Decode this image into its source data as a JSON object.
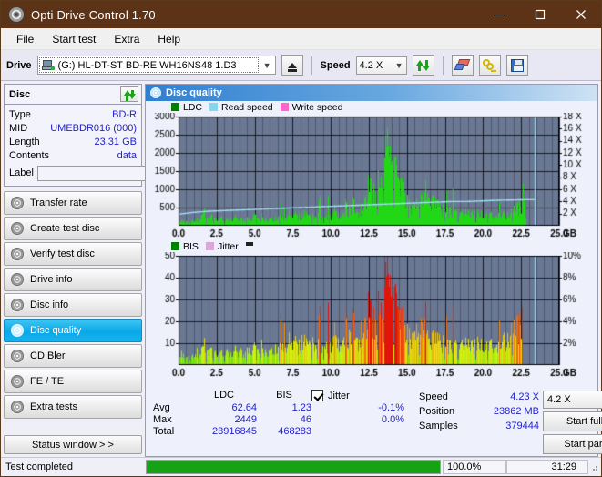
{
  "window": {
    "title": "Opti Drive Control 1.70",
    "minimize": "–",
    "maximize": "□",
    "close": "✕"
  },
  "menu": {
    "items": [
      "File",
      "Start test",
      "Extra",
      "Help"
    ]
  },
  "toolbar": {
    "drive_label": "Drive",
    "drive_value": "(G:)  HL-DT-ST BD-RE  WH16NS48 1.D3",
    "eject_title": "Eject",
    "speed_label": "Speed",
    "speed_value": "4.2 X",
    "refresh_title": "Refresh",
    "erase_title": "Erase",
    "key_title": "Tools",
    "save_title": "Save"
  },
  "disc_panel": {
    "title": "Disc",
    "refresh_title": "Refresh disc",
    "rows": [
      {
        "key": "Type",
        "value": "BD-R"
      },
      {
        "key": "MID",
        "value": "UMEBDR016 (000)"
      },
      {
        "key": "Length",
        "value": "23.31 GB"
      },
      {
        "key": "Contents",
        "value": "data"
      }
    ],
    "label_key": "Label",
    "label_value": ""
  },
  "nav": {
    "items": [
      {
        "label": "Transfer rate",
        "selected": false
      },
      {
        "label": "Create test disc",
        "selected": false
      },
      {
        "label": "Verify test disc",
        "selected": false
      },
      {
        "label": "Drive info",
        "selected": false
      },
      {
        "label": "Disc info",
        "selected": false
      },
      {
        "label": "Disc quality",
        "selected": true
      },
      {
        "label": "CD Bler",
        "selected": false
      },
      {
        "label": "FE / TE",
        "selected": false
      },
      {
        "label": "Extra tests",
        "selected": false
      }
    ],
    "status_window": "Status window > >"
  },
  "main": {
    "header": "Disc quality"
  },
  "stats": {
    "col_headers": [
      "LDC",
      "BIS"
    ],
    "jitter_label": "Jitter",
    "jitter_checked": true,
    "rows": [
      {
        "label": "Avg",
        "ldc": "62.64",
        "bis": "1.23",
        "jitter": "-0.1%"
      },
      {
        "label": "Max",
        "ldc": "2449",
        "bis": "46",
        "jitter": "0.0%"
      },
      {
        "label": "Total",
        "ldc": "23916845",
        "bis": "468283",
        "jitter": ""
      }
    ],
    "speed_key": "Speed",
    "speed_value": "4.23 X",
    "position_key": "Position",
    "position_value": "23862 MB",
    "samples_key": "Samples",
    "samples_value": "379444",
    "speed_select": "4.2 X",
    "start_full": "Start full",
    "start_part": "Start part"
  },
  "statusbar": {
    "message": "Test completed",
    "progress_percent": "100.0%",
    "progress_value": 100,
    "elapsed": "31:29"
  },
  "chart_data": [
    {
      "type": "area",
      "name": "ldc-chart",
      "title": "",
      "xlabel": "GB",
      "ylabel": "LDC",
      "xlim": [
        0,
        25
      ],
      "ylim": [
        0,
        3000
      ],
      "xticks": [
        "0.0",
        "2.5",
        "5.0",
        "7.5",
        "10.0",
        "12.5",
        "15.0",
        "17.5",
        "20.0",
        "22.5",
        "25.0"
      ],
      "yticks": [
        500,
        1000,
        1500,
        2000,
        2500,
        3000
      ],
      "y2lim": [
        0,
        18
      ],
      "y2ticks": [
        "2 X",
        "4 X",
        "6 X",
        "8 X",
        "10 X",
        "12 X",
        "14 X",
        "16 X",
        "18 X"
      ],
      "y2label": "X",
      "grid": true,
      "legend_position": "top-left",
      "legend": [
        {
          "name": "LDC",
          "color": "#008000"
        },
        {
          "name": "Read speed",
          "color": "#87d6f0"
        },
        {
          "name": "Write speed",
          "color": "#ff66cc"
        }
      ],
      "plot_bg": "#6b7894",
      "data_end_gb": 23.4,
      "cursor_color": "#7fe0f5",
      "series": [
        {
          "name": "LDC",
          "color": "#22d816",
          "kind": "bars",
          "x": [
            0.0,
            0.2,
            0.4,
            0.6,
            0.8,
            1.0,
            1.2,
            1.4,
            1.6,
            1.8,
            2.0,
            2.2,
            2.4,
            2.6,
            2.8,
            3.0,
            3.2,
            3.4,
            3.6,
            3.8,
            4.0,
            4.2,
            4.4,
            4.6,
            4.8,
            5.0,
            5.2,
            5.4,
            5.6,
            5.8,
            6.0,
            6.2,
            6.4,
            6.6,
            6.8,
            7.0,
            7.2,
            7.4,
            7.6,
            7.8,
            8.0,
            8.2,
            8.4,
            8.6,
            8.8,
            9.0,
            9.2,
            9.4,
            9.6,
            9.8,
            10.0,
            10.2,
            10.4,
            10.6,
            10.8,
            11.0,
            11.2,
            11.4,
            11.6,
            11.8,
            12.0,
            12.2,
            12.4,
            12.6,
            12.8,
            13.0,
            13.2,
            13.4,
            13.6,
            13.8,
            14.0,
            14.2,
            14.4,
            14.6,
            14.8,
            15.0,
            15.2,
            15.4,
            15.6,
            15.8,
            16.0,
            16.2,
            16.4,
            16.6,
            16.8,
            17.0,
            17.2,
            17.4,
            17.6,
            17.8,
            18.0,
            18.2,
            18.4,
            18.6,
            18.8,
            19.0,
            19.2,
            19.4,
            19.6,
            19.8,
            20.0,
            20.2,
            20.4,
            20.6,
            20.8,
            21.0,
            21.2,
            21.4,
            21.6,
            21.8,
            22.0,
            22.2,
            22.4,
            22.6,
            22.8,
            23.0,
            23.2,
            23.4
          ],
          "values": [
            180,
            150,
            170,
            140,
            200,
            160,
            190,
            210,
            320,
            180,
            250,
            300,
            200,
            180,
            260,
            170,
            210,
            190,
            230,
            170,
            200,
            240,
            190,
            220,
            200,
            310,
            230,
            190,
            240,
            200,
            270,
            210,
            250,
            230,
            290,
            240,
            420,
            300,
            350,
            260,
            300,
            380,
            310,
            260,
            320,
            280,
            400,
            330,
            280,
            350,
            300,
            420,
            360,
            300,
            380,
            330,
            450,
            380,
            320,
            400,
            360,
            620,
            900,
            1150,
            1050,
            1250,
            1400,
            1900,
            2450,
            2100,
            2300,
            1750,
            1500,
            1350,
            1200,
            900,
            650,
            600,
            680,
            750,
            820,
            900,
            1100,
            820,
            700,
            620,
            560,
            500,
            470,
            450,
            430,
            400,
            420,
            380,
            400,
            360,
            380,
            350,
            370,
            340,
            360,
            330,
            350,
            320,
            340,
            330,
            350,
            340,
            380,
            420,
            480,
            560,
            620,
            700,
            760
          ]
        },
        {
          "name": "Read speed",
          "color": "#9fe0f5",
          "kind": "line",
          "x": [
            0.0,
            1.0,
            2.0,
            3.0,
            4.0,
            5.0,
            6.0,
            7.0,
            8.0,
            9.0,
            10.0,
            11.0,
            12.0,
            13.0,
            14.0,
            15.0,
            16.0,
            17.0,
            18.0,
            19.0,
            20.0,
            21.0,
            22.0,
            23.0,
            23.4
          ],
          "values_x": [
            1.9,
            2.2,
            2.4,
            2.5,
            2.6,
            2.7,
            2.8,
            2.9,
            3.0,
            3.1,
            3.2,
            3.3,
            3.4,
            3.5,
            3.6,
            3.7,
            3.8,
            3.9,
            4.0,
            4.0,
            4.1,
            4.2,
            4.25,
            4.3,
            4.3
          ]
        }
      ]
    },
    {
      "type": "area",
      "name": "bis-chart",
      "title": "",
      "xlabel": "GB",
      "ylabel": "BIS",
      "xlim": [
        0,
        25
      ],
      "ylim": [
        0,
        50
      ],
      "xticks": [
        "0.0",
        "2.5",
        "5.0",
        "7.5",
        "10.0",
        "12.5",
        "15.0",
        "17.5",
        "20.0",
        "22.5",
        "25.0"
      ],
      "yticks": [
        10,
        20,
        30,
        40,
        50
      ],
      "y2lim": [
        0,
        10
      ],
      "y2ticks": [
        "2%",
        "4%",
        "6%",
        "8%",
        "10%"
      ],
      "grid": true,
      "legend_position": "top-left",
      "legend": [
        {
          "name": "BIS",
          "color": "#008000"
        },
        {
          "name": "Jitter",
          "color": "#d8a8d8"
        }
      ],
      "plot_bg": "#6b7894",
      "data_end_gb": 23.4,
      "cursor_color": "#7fe0f5",
      "series": [
        {
          "name": "BIS",
          "kind": "bars-gradient",
          "x": [
            0.0,
            0.2,
            0.4,
            0.6,
            0.8,
            1.0,
            1.2,
            1.4,
            1.6,
            1.8,
            2.0,
            2.2,
            2.4,
            2.6,
            2.8,
            3.0,
            3.2,
            3.4,
            3.6,
            3.8,
            4.0,
            4.2,
            4.4,
            4.6,
            4.8,
            5.0,
            5.2,
            5.4,
            5.6,
            5.8,
            6.0,
            6.2,
            6.4,
            6.6,
            6.8,
            7.0,
            7.2,
            7.4,
            7.6,
            7.8,
            8.0,
            8.2,
            8.4,
            8.6,
            8.8,
            9.0,
            9.2,
            9.4,
            9.6,
            9.8,
            10.0,
            10.2,
            10.4,
            10.6,
            10.8,
            11.0,
            11.2,
            11.4,
            11.6,
            11.8,
            12.0,
            12.2,
            12.4,
            12.6,
            12.8,
            13.0,
            13.2,
            13.4,
            13.6,
            13.8,
            14.0,
            14.2,
            14.4,
            14.6,
            14.8,
            15.0,
            15.2,
            15.4,
            15.6,
            15.8,
            16.0,
            16.2,
            16.4,
            16.6,
            16.8,
            17.0,
            17.2,
            17.4,
            17.6,
            17.8,
            18.0,
            18.2,
            18.4,
            18.6,
            18.8,
            19.0,
            19.2,
            19.4,
            19.6,
            19.8,
            20.0,
            20.2,
            20.4,
            20.6,
            20.8,
            21.0,
            21.2,
            21.4,
            21.6,
            21.8,
            22.0,
            22.2,
            22.4,
            22.6,
            22.8,
            23.0,
            23.2,
            23.4
          ],
          "values": [
            5,
            6,
            5,
            4,
            6,
            5,
            7,
            6,
            8,
            5,
            9,
            7,
            6,
            5,
            7,
            6,
            8,
            6,
            7,
            5,
            8,
            7,
            6,
            8,
            7,
            9,
            8,
            6,
            9,
            7,
            10,
            8,
            9,
            7,
            11,
            9,
            14,
            11,
            12,
            9,
            11,
            13,
            10,
            9,
            12,
            10,
            13,
            11,
            10,
            12,
            11,
            14,
            12,
            10,
            13,
            11,
            14,
            12,
            11,
            13,
            12,
            18,
            22,
            26,
            24,
            28,
            31,
            38,
            46,
            40,
            42,
            34,
            30,
            27,
            24,
            20,
            16,
            15,
            17,
            18,
            19,
            21,
            17,
            15,
            14,
            13,
            12,
            11,
            11,
            10,
            11,
            10,
            11,
            10,
            11,
            10,
            11,
            10,
            11,
            10,
            11,
            10,
            11,
            10,
            11,
            10,
            12,
            13,
            15,
            17,
            18,
            20,
            22,
            26
          ]
        }
      ]
    }
  ]
}
